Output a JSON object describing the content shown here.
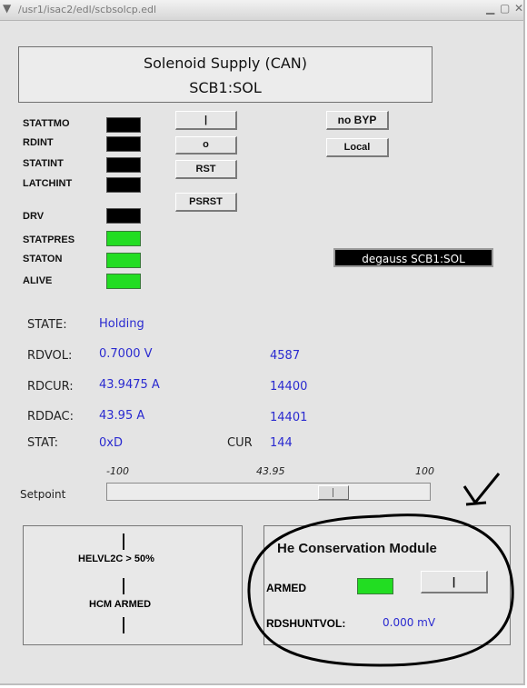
{
  "window": {
    "title": "/usr1/isac2/edl/scbsolcp.edl",
    "menu_icon": "chevron-down-icon",
    "controls": [
      "minimize-icon",
      "maximize-icon",
      "close-icon"
    ]
  },
  "header": {
    "line1": "Solenoid Supply (CAN)",
    "line2": "SCB1:SOL"
  },
  "signals": [
    {
      "label": "STATTMO",
      "state": "off"
    },
    {
      "label": "RDINT",
      "state": "off"
    },
    {
      "label": "STATINT",
      "state": "off"
    },
    {
      "label": "LATCHINT",
      "state": "off"
    },
    {
      "label": "DRV",
      "state": "off"
    },
    {
      "label": "STATPRES",
      "state": "on"
    },
    {
      "label": "STATON",
      "state": "on"
    },
    {
      "label": "ALIVE",
      "state": "on"
    }
  ],
  "buttons": {
    "on": "|",
    "off": "o",
    "rst": "RST",
    "psrst": "PSRST",
    "bypass": "no BYP",
    "local": "Local"
  },
  "degauss": "degauss SCB1:SOL",
  "readbacks": {
    "state": {
      "label": "STATE:",
      "value": "Holding"
    },
    "rdvol": {
      "label": "RDVOL:",
      "value": "0.7000 V",
      "raw": "4587"
    },
    "rdcur": {
      "label": "RDCUR:",
      "value": "43.9475 A",
      "raw": "14400"
    },
    "rddac": {
      "label": "RDDAC:",
      "value": "43.95 A",
      "raw": "14401"
    },
    "stat": {
      "label": "STAT:",
      "value": "0xD",
      "cur_label": "CUR",
      "cur_value": "144"
    }
  },
  "setpoint": {
    "label": "Setpoint",
    "min": "-100",
    "max": "100",
    "value_text": "43.95",
    "value": 43.95,
    "min_num": -100,
    "max_num": 100
  },
  "interlock": {
    "top": "HELVL2C > 50%",
    "bottom": "HCM ARMED"
  },
  "hcm": {
    "title": "He Conservation Module",
    "armed_label": "ARMED",
    "armed_button": "|",
    "shunt_label": "RDSHUNTVOL:",
    "shunt_value": "0.000 mV"
  },
  "colors": {
    "led_on": "#22dd22",
    "led_off": "#000000",
    "value_blue": "#2a2ad0"
  }
}
